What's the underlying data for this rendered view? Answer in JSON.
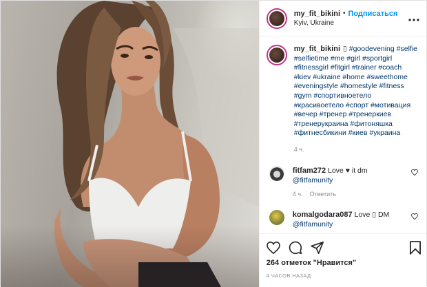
{
  "header": {
    "username": "my_fit_bikini",
    "separator": "•",
    "follow_label": "Подписаться",
    "location": "Kyiv, Ukraine",
    "more_icon": "more-horizontal-icon"
  },
  "caption": {
    "username": "my_fit_bikini",
    "emoji": "▯",
    "hashtags": [
      "#goodevening",
      "#selfie",
      "#selfietime",
      "#me",
      "#girl",
      "#sportgirl",
      "#fitnessgirl",
      "#fitgirl",
      "#trainer",
      "#coach",
      "#kiev",
      "#ukraine",
      "#home",
      "#sweethome",
      "#eveningstyle",
      "#homestyle",
      "#fitness",
      "#gym",
      "#спортивноетело",
      "#красивоетело",
      "#спорт",
      "#мотивация",
      "#вечер",
      "#тренер",
      "#тренеркиев",
      "#тренерукраина",
      "#фитоняшка",
      "#фитнесбикини",
      "#киев",
      "#украина"
    ],
    "age": "4 ч."
  },
  "comments": [
    {
      "username": "fitfam272",
      "text_before": "Love",
      "heart": "♥",
      "text_after": "it dm",
      "mention": "@fitfamunity",
      "age": "4 ч.",
      "reply_label": "Ответить"
    },
    {
      "username": "komalgodara087",
      "text_before": "Love",
      "heart": "▯",
      "text_after": "DM",
      "mention": "@fitfamunity",
      "age": "",
      "reply_label": ""
    }
  ],
  "actions": {
    "likes": "264 отметок \"Нравится\"",
    "timestamp": "4 ЧАСОВ НАЗАД"
  },
  "colors": {
    "accent": "#0095f6",
    "link": "#00376b",
    "muted": "#8e8e8e",
    "ring": "#c13584"
  }
}
